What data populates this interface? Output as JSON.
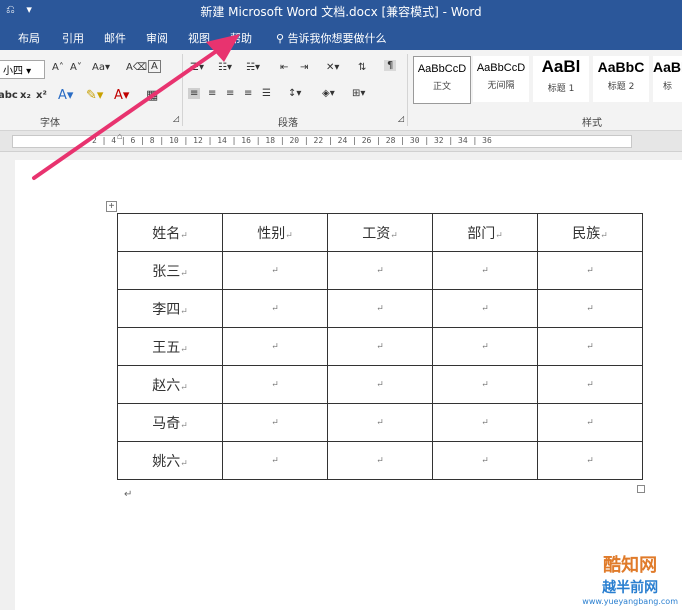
{
  "window": {
    "title": "新建 Microsoft Word 文档.docx [兼容模式]  -  Word"
  },
  "tabs": [
    {
      "label": "布局"
    },
    {
      "label": "引用"
    },
    {
      "label": "邮件"
    },
    {
      "label": "审阅"
    },
    {
      "label": "视图"
    },
    {
      "label": "帮助"
    }
  ],
  "tell_me": {
    "label": "告诉我你想要做什么"
  },
  "font": {
    "size_value": "小四",
    "group_label": "字体"
  },
  "paragraph": {
    "group_label": "段落"
  },
  "styles": {
    "group_label": "样式",
    "items": [
      {
        "sample": "AaBbCcD",
        "name": "正文"
      },
      {
        "sample": "AaBbCcD",
        "name": "无间隔"
      },
      {
        "sample": "AaBl",
        "name": "标题 1"
      },
      {
        "sample": "AaBbC",
        "name": "标题 2"
      },
      {
        "sample": "AaBl",
        "name": "标"
      }
    ]
  },
  "ruler": {
    "ticks": "2  |  4  |  6  |  8  |  10  |  12  |  14  |  16  |  18  |  20  |  22  |  24  |  26  |  28  |  30  |  32  |  34  |  36"
  },
  "table": {
    "headers": [
      "姓名",
      "性别",
      "工资",
      "部门",
      "民族"
    ],
    "names": [
      "张三",
      "李四",
      "王五",
      "赵六",
      "马奇",
      "姚六"
    ],
    "mark": "↵"
  },
  "watermark": {
    "line1": "酷知网",
    "line2": "越半前网",
    "url": "www.yueyangbang.com"
  },
  "colors": {
    "titlebar": "#2b579a",
    "arrow": "#e8336f"
  }
}
